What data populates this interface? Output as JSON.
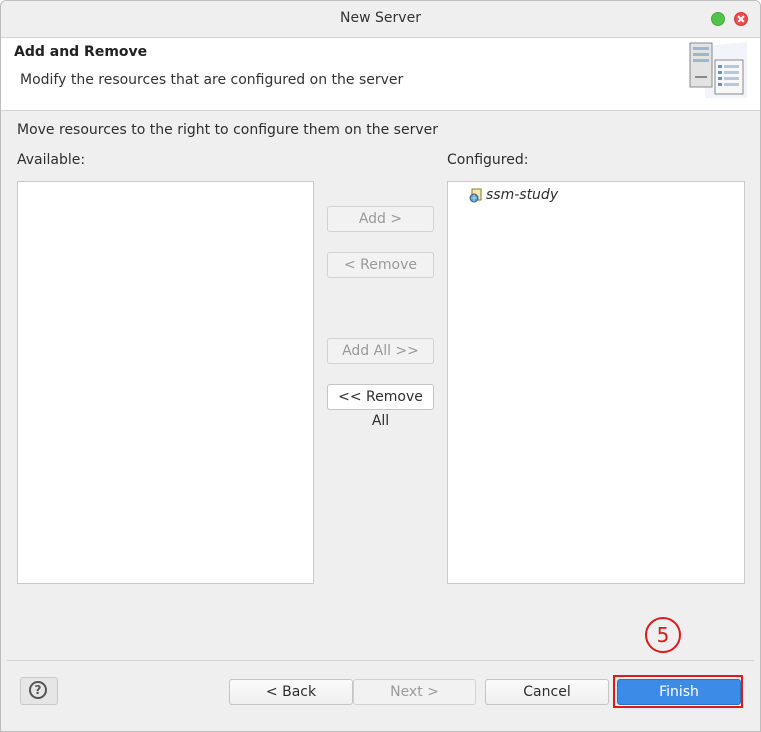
{
  "window": {
    "title": "New Server"
  },
  "header": {
    "title": "Add and Remove",
    "description": "Modify the resources that are configured on the server",
    "icon": "server-icon"
  },
  "body": {
    "instruction": "Move resources to the right to configure them on the server",
    "available_label": "Available:",
    "configured_label": "Configured:",
    "available_items": [],
    "configured_items": [
      {
        "label": "ssm-study",
        "icon": "web-project-icon"
      }
    ]
  },
  "transfer_buttons": {
    "add": "Add >",
    "remove": "< Remove",
    "add_all": "Add All >>",
    "remove_all": "<< Remove All"
  },
  "footer": {
    "help_icon": "help-icon",
    "back": "< Back",
    "next": "Next >",
    "cancel": "Cancel",
    "finish": "Finish"
  },
  "annotation": {
    "step_number": "5",
    "color": "#e0191a"
  },
  "colors": {
    "finish_button": "#3c8ce7",
    "window_background": "#efefef"
  }
}
